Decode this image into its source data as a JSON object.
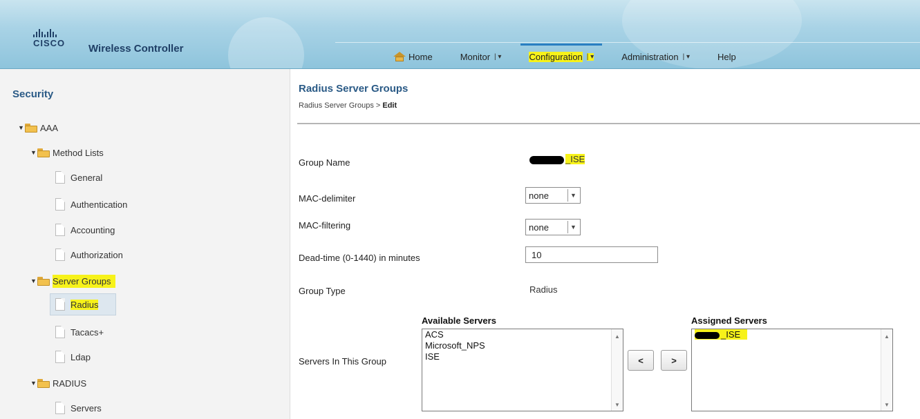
{
  "header": {
    "logo_text": "CISCO",
    "app_title": "Wireless Controller",
    "nav": [
      {
        "label": "Home",
        "arrow": ""
      },
      {
        "label": "Monitor",
        "arrow": "| ▾"
      },
      {
        "label": "Configuration",
        "arrow": "| ▾"
      },
      {
        "label": "Administration",
        "arrow": "| ▾"
      },
      {
        "label": "Help",
        "arrow": ""
      }
    ],
    "active_nav": "Configuration"
  },
  "sidebar": {
    "title": "Security",
    "tree": [
      {
        "label": "AAA",
        "type": "folder"
      },
      {
        "label": "Method Lists",
        "type": "folder"
      },
      {
        "label": "General",
        "type": "page"
      },
      {
        "label": "Authentication",
        "type": "page"
      },
      {
        "label": "Accounting",
        "type": "page"
      },
      {
        "label": "Authorization",
        "type": "page"
      },
      {
        "label": "Server Groups",
        "type": "folder"
      },
      {
        "label": "Radius",
        "type": "page",
        "selected": true
      },
      {
        "label": "Tacacs+",
        "type": "page"
      },
      {
        "label": "Ldap",
        "type": "page"
      },
      {
        "label": "RADIUS",
        "type": "folder"
      },
      {
        "label": "Servers",
        "type": "page"
      }
    ]
  },
  "main": {
    "title": "Radius Server Groups",
    "breadcrumb_parent": "Radius Server Groups >",
    "breadcrumb_current": "Edit",
    "form": {
      "group_name_label": "Group Name",
      "group_name_suffix": "_ISE",
      "mac_delimiter_label": "MAC-delimiter",
      "mac_delimiter_value": "none",
      "mac_filtering_label": "MAC-filtering",
      "mac_filtering_value": "none",
      "dead_time_label": "Dead-time (0-1440) in minutes",
      "dead_time_value": "10",
      "group_type_label": "Group Type",
      "group_type_value": "Radius",
      "servers_label": "Servers In This Group"
    },
    "available_servers": {
      "heading": "Available Servers",
      "items": [
        "ACS",
        "Microsoft_NPS",
        "ISE"
      ]
    },
    "assigned_servers": {
      "heading": "Assigned Servers",
      "item_suffix": "_ISE"
    },
    "buttons": {
      "move_left": "<",
      "move_right": ">"
    }
  },
  "colors": {
    "highlight": "#f7f21a",
    "title_blue": "#2a5a86",
    "header_blue": "#a9d3e6"
  }
}
